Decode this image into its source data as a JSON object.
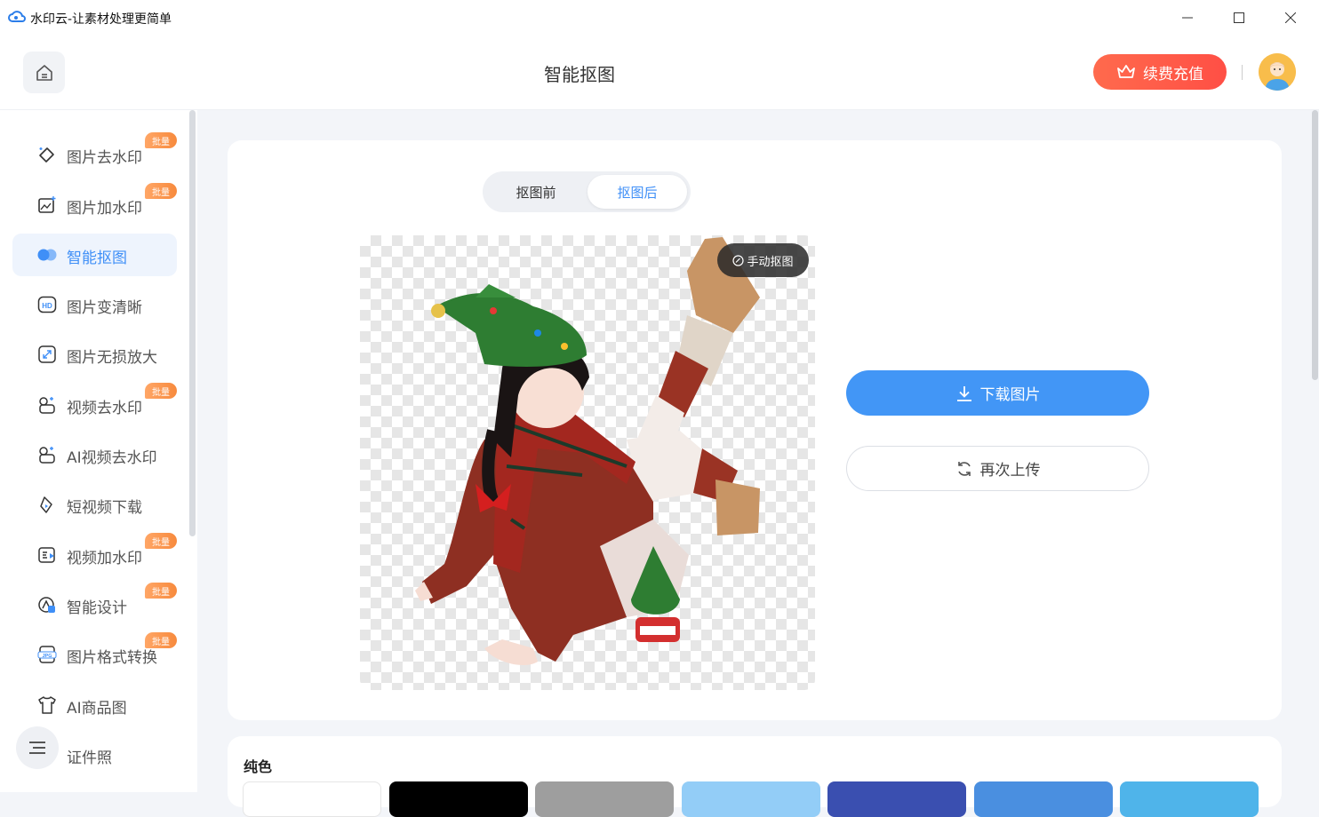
{
  "window": {
    "title": "水印云-让素材处理更简单"
  },
  "header": {
    "title": "智能抠图",
    "recharge_label": "续费充值"
  },
  "sidebar": {
    "badge_text": "批量",
    "items": [
      {
        "label": "图片去水印",
        "icon": "eraser-icon",
        "badge": true
      },
      {
        "label": "图片加水印",
        "icon": "image-add-icon",
        "badge": true
      },
      {
        "label": "智能抠图",
        "icon": "cutout-icon",
        "badge": false,
        "active": true
      },
      {
        "label": "图片变清晰",
        "icon": "hd-icon",
        "badge": false
      },
      {
        "label": "图片无损放大",
        "icon": "enlarge-icon",
        "badge": false
      },
      {
        "label": "视频去水印",
        "icon": "video-eraser-icon",
        "badge": true
      },
      {
        "label": "AI视频去水印",
        "icon": "ai-video-icon",
        "badge": false
      },
      {
        "label": "短视频下载",
        "icon": "short-video-download-icon",
        "badge": false
      },
      {
        "label": "视频加水印",
        "icon": "video-add-watermark-icon",
        "badge": true
      },
      {
        "label": "智能设计",
        "icon": "design-icon",
        "badge": true
      },
      {
        "label": "图片格式转换",
        "icon": "jpg-format-icon",
        "badge": true
      },
      {
        "label": "AI商品图",
        "icon": "tshirt-icon",
        "badge": false
      },
      {
        "label": "证件照",
        "icon": "id-photo-icon",
        "badge": false
      }
    ]
  },
  "main": {
    "toggle": {
      "before": "抠图前",
      "after": "抠图后"
    },
    "manual_cutout": "手动抠图",
    "download_label": "下载图片",
    "reupload_label": "再次上传",
    "solid_label": "纯色",
    "swatches": [
      "#ffffff",
      "#000000",
      "#9e9e9e",
      "#93cdf7",
      "#3a4fb0",
      "#4a8fe0",
      "#4fb4ea"
    ]
  }
}
